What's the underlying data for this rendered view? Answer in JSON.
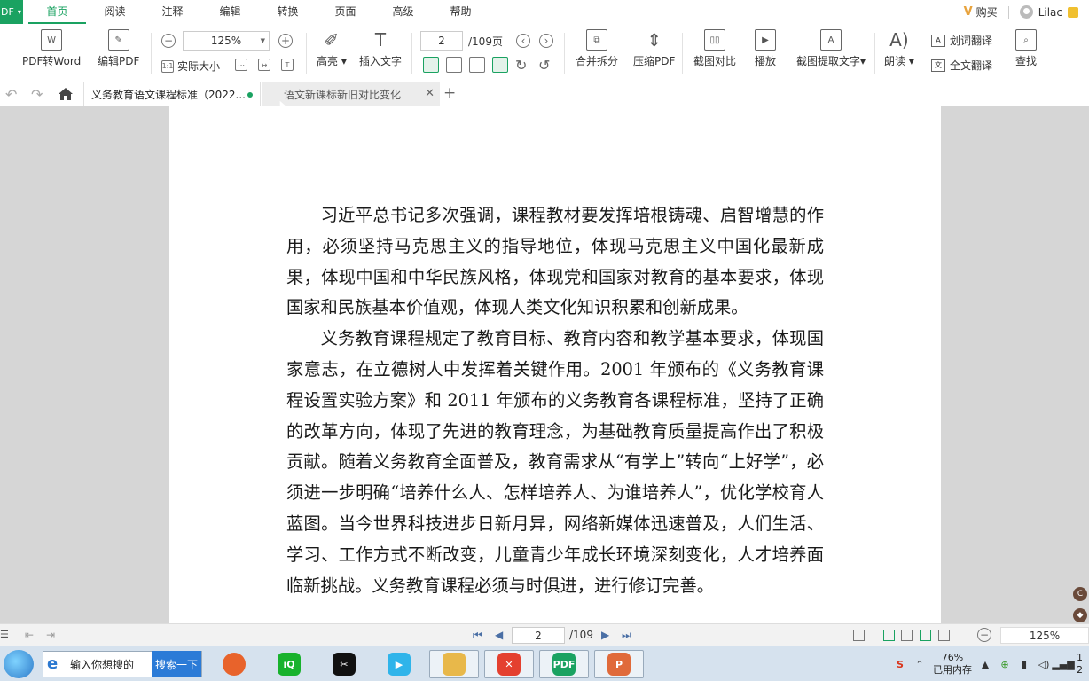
{
  "app": {
    "badge": "DF"
  },
  "menu": {
    "items": [
      "首页",
      "阅读",
      "注释",
      "编辑",
      "转换",
      "页面",
      "高级",
      "帮助"
    ],
    "active_index": 0,
    "buy": "购买",
    "user": "Lilac"
  },
  "ribbon": {
    "pdf_to_word": "PDF转Word",
    "edit_pdf": "编辑PDF",
    "zoom": "125%",
    "actual_size": "实际大小",
    "highlight": "高亮",
    "insert_text": "插入文字",
    "page_current": "2",
    "page_total": "/109页",
    "merge_split": "合并拆分",
    "compress": "压缩PDF",
    "compare": "截图对比",
    "play": "播放",
    "ocr": "截图提取文字",
    "read_aloud": "朗读",
    "word_translate": "划词翻译",
    "full_translate": "全文翻译",
    "find": "查找"
  },
  "tabs": [
    {
      "label": "义务教育语文课程标准（2022...",
      "active": true
    },
    {
      "label": "语文新课标新旧对比变化",
      "active": false
    }
  ],
  "document": {
    "paragraphs": [
      "习近平总书记多次强调，课程教材要发挥培根铸魂、启智增慧的作用，必须坚持马克思主义的指导地位，体现马克思主义中国化最新成果，体现中国和中华民族风格，体现党和国家对教育的基本要求，体现国家和民族基本价值观，体现人类文化知识积累和创新成果。",
      "义务教育课程规定了教育目标、教育内容和教学基本要求，体现国家意志，在立德树人中发挥着关键作用。2001 年颁布的《义务教育课程设置实验方案》和 2011 年颁布的义务教育各课程标准，坚持了正确的改革方向，体现了先进的教育理念，为基础教育质量提高作出了积极贡献。随着义务教育全面普及，教育需求从“有学上”转向“上好学”，必须进一步明确“培养什么人、怎样培养人、为谁培养人”，优化学校育人蓝图。当今世界科技进步日新月异，网络新媒体迅速普及，人们生活、学习、工作方式不断改变，儿童青少年成长环境深刻变化，人才培养面临新挑战。义务教育课程必须与时俱进，进行修订完善。"
    ]
  },
  "statusbar": {
    "page_current": "2",
    "page_total": "/109",
    "zoom": "125%"
  },
  "taskbar": {
    "search_placeholder": "输入你想搜的",
    "search_button": "搜索一下",
    "memory_percent": "76%",
    "memory_label": "已用内存",
    "clock_partial": "1\n2"
  }
}
